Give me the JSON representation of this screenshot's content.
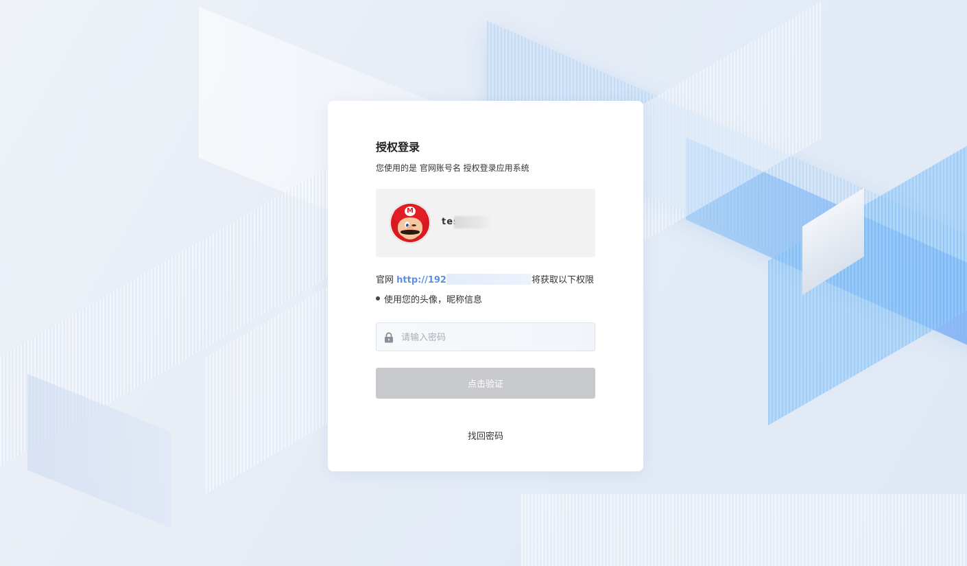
{
  "auth": {
    "title": "授权登录",
    "subtitle": "您使用的是 官网账号名 授权登录应用系统",
    "account": {
      "username": "tes",
      "avatar_icon": "mario-avatar"
    },
    "permission": {
      "prefix": "官网 ",
      "link_text": "http://192",
      "suffix": "将获取以下权限",
      "items": [
        "使用您的头像，昵称信息"
      ]
    },
    "password": {
      "placeholder": "请输入密码",
      "value": "",
      "icon": "lock-icon"
    },
    "verify_label": "点击验证",
    "forgot_label": "找回密码"
  },
  "colors": {
    "link": "#5b8fe6",
    "button_disabled": "#c8c9cc",
    "account_box": "#f2f2f2"
  }
}
